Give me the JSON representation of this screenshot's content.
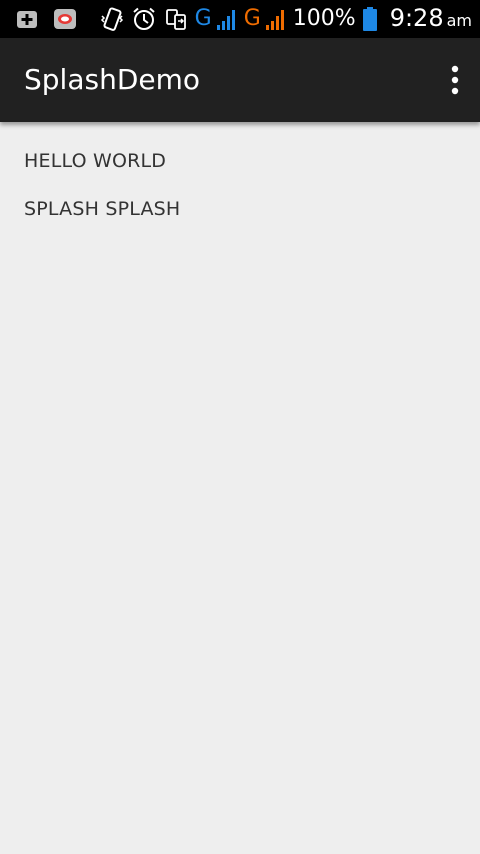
{
  "status_bar": {
    "left_icons": [
      "add-box-icon",
      "sms-app-icon"
    ],
    "right_icons": [
      "vibrate-icon",
      "alarm-icon",
      "data-transfer-icon"
    ],
    "sim1_network": "G",
    "sim2_network": "G",
    "sim1_color": "#1e88e5",
    "sim2_color": "#ef6c00",
    "battery_percent": "100%",
    "time": "9:28",
    "ampm": "am"
  },
  "app_bar": {
    "title": "SplashDemo",
    "background": "#212121",
    "overflow_icon": "more-vert-icon"
  },
  "content": {
    "lines": [
      "HELLO WORLD",
      "SPLASH SPLASH"
    ]
  }
}
